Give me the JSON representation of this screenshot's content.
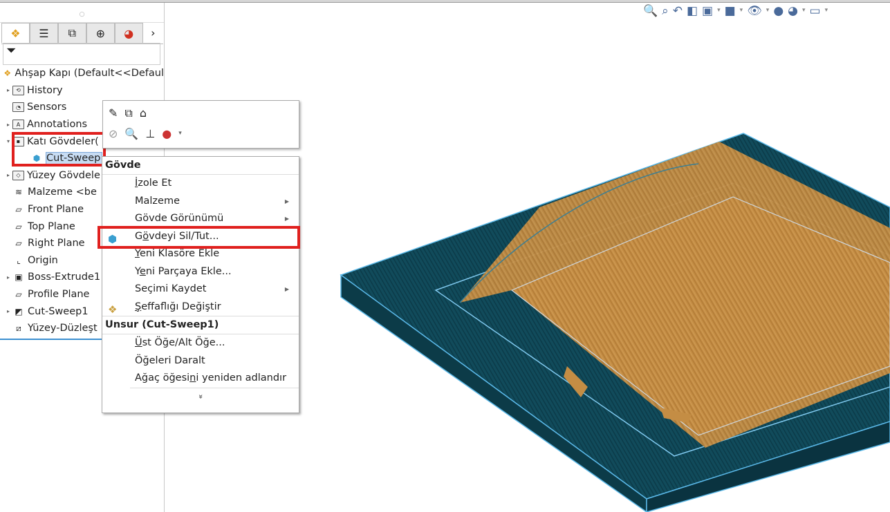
{
  "tree": {
    "root": "Ahşap Kapı  (Default<<Defaul",
    "items": [
      {
        "label": "History",
        "expand": true,
        "icon": "history-folder-icon"
      },
      {
        "label": "Sensors",
        "expand": false,
        "icon": "sensors-folder-icon"
      },
      {
        "label": "Annotations",
        "expand": true,
        "icon": "annotations-folder-icon"
      },
      {
        "label": "Katı Gövdeler(",
        "expand": true,
        "icon": "solid-bodies-folder-icon"
      },
      {
        "label": "Cut-Sweep",
        "expand": false,
        "icon": "body-icon",
        "indent": true,
        "selected": true
      },
      {
        "label": "Yüzey Gövdele",
        "expand": true,
        "icon": "surface-bodies-folder-icon"
      },
      {
        "label": "Malzeme <be",
        "expand": false,
        "icon": "material-icon"
      },
      {
        "label": "Front Plane",
        "expand": false,
        "icon": "plane-icon"
      },
      {
        "label": "Top Plane",
        "expand": false,
        "icon": "plane-icon"
      },
      {
        "label": "Right Plane",
        "expand": false,
        "icon": "plane-icon"
      },
      {
        "label": "Origin",
        "expand": false,
        "icon": "origin-icon"
      },
      {
        "label": "Boss-Extrude1",
        "expand": true,
        "icon": "extrude-icon"
      },
      {
        "label": "Profile Plane",
        "expand": false,
        "icon": "plane-icon"
      },
      {
        "label": "Cut-Sweep1",
        "expand": true,
        "icon": "sweep-icon"
      },
      {
        "label": "Yüzey-Düzleşt",
        "expand": false,
        "icon": "surface-flatten-icon"
      }
    ]
  },
  "panel_tabs": [
    "feature-manager",
    "property-manager",
    "configuration-manager",
    "dimxpert",
    "display-manager"
  ],
  "context_menu": {
    "section1": "Gövde",
    "items1": [
      {
        "pre": "",
        "u": "İ",
        "post": "zole Et",
        "submenu": false
      },
      {
        "pre": "Malzeme",
        "u": "",
        "post": "",
        "submenu": true
      },
      {
        "pre": "Gövde Görünümü",
        "u": "",
        "post": "",
        "submenu": true
      },
      {
        "pre": "G",
        "u": "ö",
        "post": "vdeyi Sil/Tut...",
        "submenu": false,
        "highlight": true
      },
      {
        "pre": "",
        "u": "Y",
        "post": "eni Klasöre Ekle",
        "submenu": false
      },
      {
        "pre": "Y",
        "u": "e",
        "post": "ni Parçaya Ekle...",
        "submenu": false
      },
      {
        "pre": "Seçimi Kaydet",
        "u": "",
        "post": "",
        "submenu": true
      },
      {
        "pre": "",
        "u": "Ş",
        "post": "effaflığı Değiştir",
        "submenu": false
      }
    ],
    "section2": "Unsur (Cut-Sweep1)",
    "items2": [
      {
        "pre": "",
        "u": "Ü",
        "post": "st Öğe/Alt Öğe..."
      },
      {
        "pre": "Ö",
        "u": "ğ",
        "post": "eleri Daralt"
      },
      {
        "pre": "Ağaç öğesi",
        "u": "n",
        "post": "i yeniden adlandır"
      }
    ],
    "more": "»"
  },
  "colors": {
    "highlight_box": "#e0201e",
    "slab": "#0f4a5a",
    "edge": "#5ab8e8",
    "wood": "#c08a42",
    "selection": "#c7dcf3"
  }
}
